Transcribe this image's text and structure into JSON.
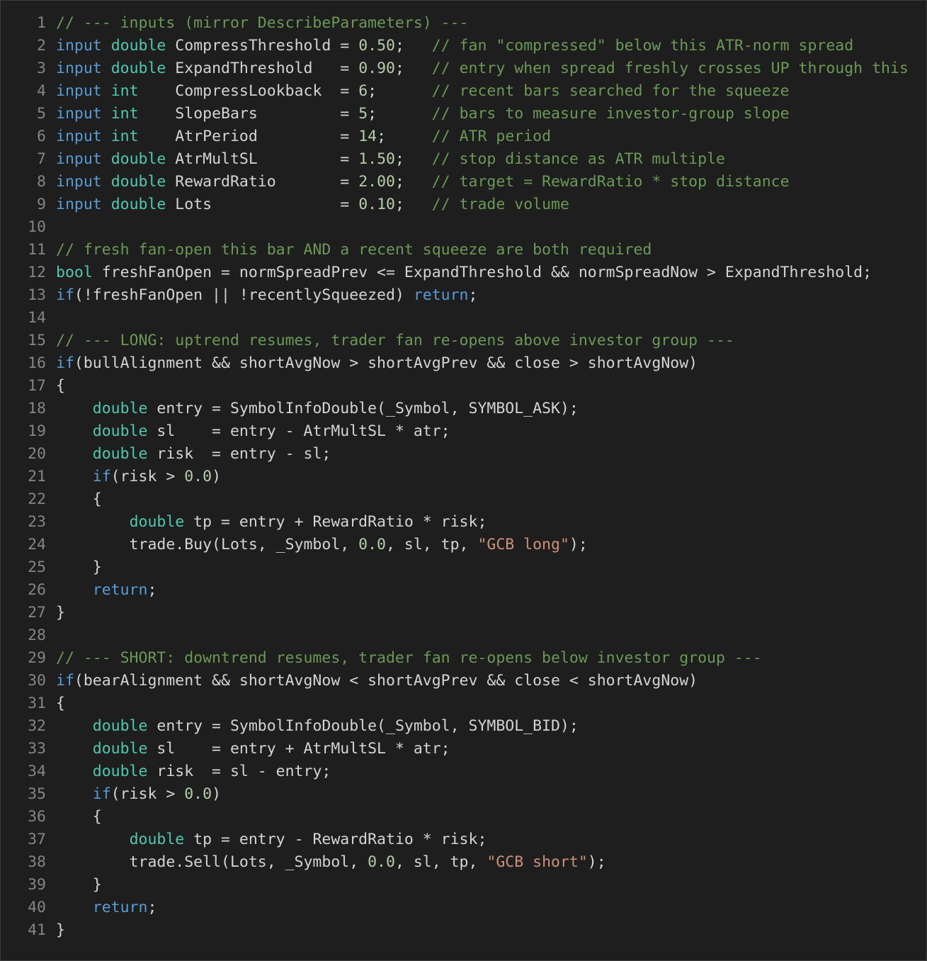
{
  "editor": {
    "language": "MQL5",
    "colors": {
      "background": "#1e1e1e",
      "line_number": "#858585",
      "keyword": "#569cd6",
      "type": "#4ec9b0",
      "number": "#b5cea8",
      "string": "#ce9178",
      "comment": "#6a9955",
      "identifier": "#d4d4d4"
    },
    "lines": [
      {
        "n": "1",
        "tokens": [
          {
            "t": "cm",
            "v": "// --- inputs (mirror DescribeParameters) ---"
          }
        ]
      },
      {
        "n": "2",
        "tokens": [
          {
            "t": "kw",
            "v": "input"
          },
          {
            "t": "id",
            "v": " "
          },
          {
            "t": "type",
            "v": "double"
          },
          {
            "t": "id",
            "v": " CompressThreshold = "
          },
          {
            "t": "num",
            "v": "0.50"
          },
          {
            "t": "id",
            "v": ";   "
          },
          {
            "t": "cm",
            "v": "// fan \"compressed\" below this ATR-norm spread"
          }
        ]
      },
      {
        "n": "3",
        "tokens": [
          {
            "t": "kw",
            "v": "input"
          },
          {
            "t": "id",
            "v": " "
          },
          {
            "t": "type",
            "v": "double"
          },
          {
            "t": "id",
            "v": " ExpandThreshold   = "
          },
          {
            "t": "num",
            "v": "0.90"
          },
          {
            "t": "id",
            "v": ";   "
          },
          {
            "t": "cm",
            "v": "// entry when spread freshly crosses UP through this"
          }
        ]
      },
      {
        "n": "4",
        "tokens": [
          {
            "t": "kw",
            "v": "input"
          },
          {
            "t": "id",
            "v": " "
          },
          {
            "t": "type",
            "v": "int"
          },
          {
            "t": "id",
            "v": "    CompressLookback  = "
          },
          {
            "t": "num",
            "v": "6"
          },
          {
            "t": "id",
            "v": ";      "
          },
          {
            "t": "cm",
            "v": "// recent bars searched for the squeeze"
          }
        ]
      },
      {
        "n": "5",
        "tokens": [
          {
            "t": "kw",
            "v": "input"
          },
          {
            "t": "id",
            "v": " "
          },
          {
            "t": "type",
            "v": "int"
          },
          {
            "t": "id",
            "v": "    SlopeBars         = "
          },
          {
            "t": "num",
            "v": "5"
          },
          {
            "t": "id",
            "v": ";      "
          },
          {
            "t": "cm",
            "v": "// bars to measure investor-group slope"
          }
        ]
      },
      {
        "n": "6",
        "tokens": [
          {
            "t": "kw",
            "v": "input"
          },
          {
            "t": "id",
            "v": " "
          },
          {
            "t": "type",
            "v": "int"
          },
          {
            "t": "id",
            "v": "    AtrPeriod         = "
          },
          {
            "t": "num",
            "v": "14"
          },
          {
            "t": "id",
            "v": ";     "
          },
          {
            "t": "cm",
            "v": "// ATR period"
          }
        ]
      },
      {
        "n": "7",
        "tokens": [
          {
            "t": "kw",
            "v": "input"
          },
          {
            "t": "id",
            "v": " "
          },
          {
            "t": "type",
            "v": "double"
          },
          {
            "t": "id",
            "v": " AtrMultSL         = "
          },
          {
            "t": "num",
            "v": "1.50"
          },
          {
            "t": "id",
            "v": ";   "
          },
          {
            "t": "cm",
            "v": "// stop distance as ATR multiple"
          }
        ]
      },
      {
        "n": "8",
        "tokens": [
          {
            "t": "kw",
            "v": "input"
          },
          {
            "t": "id",
            "v": " "
          },
          {
            "t": "type",
            "v": "double"
          },
          {
            "t": "id",
            "v": " RewardRatio       = "
          },
          {
            "t": "num",
            "v": "2.00"
          },
          {
            "t": "id",
            "v": ";   "
          },
          {
            "t": "cm",
            "v": "// target = RewardRatio * stop distance"
          }
        ]
      },
      {
        "n": "9",
        "tokens": [
          {
            "t": "kw",
            "v": "input"
          },
          {
            "t": "id",
            "v": " "
          },
          {
            "t": "type",
            "v": "double"
          },
          {
            "t": "id",
            "v": " Lots              = "
          },
          {
            "t": "num",
            "v": "0.10"
          },
          {
            "t": "id",
            "v": ";   "
          },
          {
            "t": "cm",
            "v": "// trade volume"
          }
        ]
      },
      {
        "n": "10",
        "tokens": []
      },
      {
        "n": "11",
        "tokens": [
          {
            "t": "cm",
            "v": "// fresh fan-open this bar AND a recent squeeze are both required"
          }
        ]
      },
      {
        "n": "12",
        "tokens": [
          {
            "t": "type",
            "v": "bool"
          },
          {
            "t": "id",
            "v": " freshFanOpen = normSpreadPrev <= ExpandThreshold && normSpreadNow > ExpandThreshold;"
          }
        ]
      },
      {
        "n": "13",
        "tokens": [
          {
            "t": "kw",
            "v": "if"
          },
          {
            "t": "id",
            "v": "(!freshFanOpen || !recentlySqueezed) "
          },
          {
            "t": "kw",
            "v": "return"
          },
          {
            "t": "id",
            "v": ";"
          }
        ]
      },
      {
        "n": "14",
        "tokens": []
      },
      {
        "n": "15",
        "tokens": [
          {
            "t": "cm",
            "v": "// --- LONG: uptrend resumes, trader fan re-opens above investor group ---"
          }
        ]
      },
      {
        "n": "16",
        "tokens": [
          {
            "t": "kw",
            "v": "if"
          },
          {
            "t": "id",
            "v": "(bullAlignment && shortAvgNow > shortAvgPrev && close > shortAvgNow)"
          }
        ]
      },
      {
        "n": "17",
        "tokens": [
          {
            "t": "id",
            "v": "{"
          }
        ]
      },
      {
        "n": "18",
        "tokens": [
          {
            "t": "id",
            "v": "    "
          },
          {
            "t": "type",
            "v": "double"
          },
          {
            "t": "id",
            "v": " entry = SymbolInfoDouble(_Symbol, SYMBOL_ASK);"
          }
        ]
      },
      {
        "n": "19",
        "tokens": [
          {
            "t": "id",
            "v": "    "
          },
          {
            "t": "type",
            "v": "double"
          },
          {
            "t": "id",
            "v": " sl    = entry - AtrMultSL * atr;"
          }
        ]
      },
      {
        "n": "20",
        "tokens": [
          {
            "t": "id",
            "v": "    "
          },
          {
            "t": "type",
            "v": "double"
          },
          {
            "t": "id",
            "v": " risk  = entry - sl;"
          }
        ]
      },
      {
        "n": "21",
        "tokens": [
          {
            "t": "id",
            "v": "    "
          },
          {
            "t": "kw",
            "v": "if"
          },
          {
            "t": "id",
            "v": "(risk > "
          },
          {
            "t": "num",
            "v": "0.0"
          },
          {
            "t": "id",
            "v": ")"
          }
        ]
      },
      {
        "n": "22",
        "tokens": [
          {
            "t": "id",
            "v": "    {"
          }
        ]
      },
      {
        "n": "23",
        "tokens": [
          {
            "t": "id",
            "v": "        "
          },
          {
            "t": "type",
            "v": "double"
          },
          {
            "t": "id",
            "v": " tp = entry + RewardRatio * risk;"
          }
        ]
      },
      {
        "n": "24",
        "tokens": [
          {
            "t": "id",
            "v": "        trade.Buy(Lots, _Symbol, "
          },
          {
            "t": "num",
            "v": "0.0"
          },
          {
            "t": "id",
            "v": ", sl, tp, "
          },
          {
            "t": "str",
            "v": "\"GCB long\""
          },
          {
            "t": "id",
            "v": ");"
          }
        ]
      },
      {
        "n": "25",
        "tokens": [
          {
            "t": "id",
            "v": "    }"
          }
        ]
      },
      {
        "n": "26",
        "tokens": [
          {
            "t": "id",
            "v": "    "
          },
          {
            "t": "kw",
            "v": "return"
          },
          {
            "t": "id",
            "v": ";"
          }
        ]
      },
      {
        "n": "27",
        "tokens": [
          {
            "t": "id",
            "v": "}"
          }
        ]
      },
      {
        "n": "28",
        "tokens": []
      },
      {
        "n": "29",
        "tokens": [
          {
            "t": "cm",
            "v": "// --- SHORT: downtrend resumes, trader fan re-opens below investor group ---"
          }
        ]
      },
      {
        "n": "30",
        "tokens": [
          {
            "t": "kw",
            "v": "if"
          },
          {
            "t": "id",
            "v": "(bearAlignment && shortAvgNow < shortAvgPrev && close < shortAvgNow)"
          }
        ]
      },
      {
        "n": "31",
        "tokens": [
          {
            "t": "id",
            "v": "{"
          }
        ]
      },
      {
        "n": "32",
        "tokens": [
          {
            "t": "id",
            "v": "    "
          },
          {
            "t": "type",
            "v": "double"
          },
          {
            "t": "id",
            "v": " entry = SymbolInfoDouble(_Symbol, SYMBOL_BID);"
          }
        ]
      },
      {
        "n": "33",
        "tokens": [
          {
            "t": "id",
            "v": "    "
          },
          {
            "t": "type",
            "v": "double"
          },
          {
            "t": "id",
            "v": " sl    = entry + AtrMultSL * atr;"
          }
        ]
      },
      {
        "n": "34",
        "tokens": [
          {
            "t": "id",
            "v": "    "
          },
          {
            "t": "type",
            "v": "double"
          },
          {
            "t": "id",
            "v": " risk  = sl - entry;"
          }
        ]
      },
      {
        "n": "35",
        "tokens": [
          {
            "t": "id",
            "v": "    "
          },
          {
            "t": "kw",
            "v": "if"
          },
          {
            "t": "id",
            "v": "(risk > "
          },
          {
            "t": "num",
            "v": "0.0"
          },
          {
            "t": "id",
            "v": ")"
          }
        ]
      },
      {
        "n": "36",
        "tokens": [
          {
            "t": "id",
            "v": "    {"
          }
        ]
      },
      {
        "n": "37",
        "tokens": [
          {
            "t": "id",
            "v": "        "
          },
          {
            "t": "type",
            "v": "double"
          },
          {
            "t": "id",
            "v": " tp = entry - RewardRatio * risk;"
          }
        ]
      },
      {
        "n": "38",
        "tokens": [
          {
            "t": "id",
            "v": "        trade.Sell(Lots, _Symbol, "
          },
          {
            "t": "num",
            "v": "0.0"
          },
          {
            "t": "id",
            "v": ", sl, tp, "
          },
          {
            "t": "str",
            "v": "\"GCB short\""
          },
          {
            "t": "id",
            "v": ");"
          }
        ]
      },
      {
        "n": "39",
        "tokens": [
          {
            "t": "id",
            "v": "    }"
          }
        ]
      },
      {
        "n": "40",
        "tokens": [
          {
            "t": "id",
            "v": "    "
          },
          {
            "t": "kw",
            "v": "return"
          },
          {
            "t": "id",
            "v": ";"
          }
        ]
      },
      {
        "n": "41",
        "tokens": [
          {
            "t": "id",
            "v": "}"
          }
        ]
      }
    ]
  }
}
